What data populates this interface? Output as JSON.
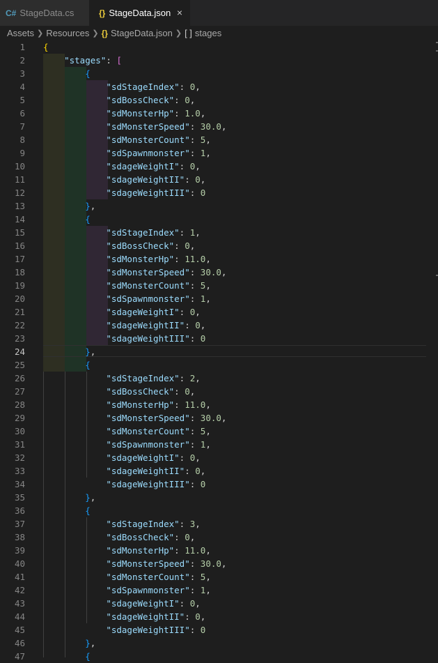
{
  "tabs": [
    {
      "icon": "C#",
      "label": "StageData.cs",
      "active": false
    },
    {
      "icon": "{}",
      "label": "StageData.json",
      "active": true,
      "close": "×"
    }
  ],
  "breadcrumb": {
    "assets": "Assets",
    "resources": "Resources",
    "json_icon": "{}",
    "file": "StageData.json",
    "array_icon": "[ ]",
    "node": "stages"
  },
  "editor": {
    "current_line": 24,
    "first_line": 1,
    "lines": [
      [
        [
          "b1",
          "{"
        ]
      ],
      [
        [
          "p",
          "    "
        ],
        [
          "k",
          "\"stages\""
        ],
        [
          "p",
          ": "
        ],
        [
          "b2",
          "["
        ]
      ],
      [
        [
          "p",
          "        "
        ],
        [
          "b3",
          "{"
        ]
      ],
      [
        [
          "p",
          "            "
        ],
        [
          "k",
          "\"sdStageIndex\""
        ],
        [
          "p",
          ": "
        ],
        [
          "n",
          "0"
        ],
        [
          "p",
          ","
        ]
      ],
      [
        [
          "p",
          "            "
        ],
        [
          "k",
          "\"sdBossCheck\""
        ],
        [
          "p",
          ": "
        ],
        [
          "n",
          "0"
        ],
        [
          "p",
          ","
        ]
      ],
      [
        [
          "p",
          "            "
        ],
        [
          "k",
          "\"sdMonsterHp\""
        ],
        [
          "p",
          ": "
        ],
        [
          "n",
          "1.0"
        ],
        [
          "p",
          ","
        ]
      ],
      [
        [
          "p",
          "            "
        ],
        [
          "k",
          "\"sdMonsterSpeed\""
        ],
        [
          "p",
          ": "
        ],
        [
          "n",
          "30.0"
        ],
        [
          "p",
          ","
        ]
      ],
      [
        [
          "p",
          "            "
        ],
        [
          "k",
          "\"sdMonsterCount\""
        ],
        [
          "p",
          ": "
        ],
        [
          "n",
          "5"
        ],
        [
          "p",
          ","
        ]
      ],
      [
        [
          "p",
          "            "
        ],
        [
          "k",
          "\"sdSpawnmonster\""
        ],
        [
          "p",
          ": "
        ],
        [
          "n",
          "1"
        ],
        [
          "p",
          ","
        ]
      ],
      [
        [
          "p",
          "            "
        ],
        [
          "k",
          "\"sdageWeightI\""
        ],
        [
          "p",
          ": "
        ],
        [
          "n",
          "0"
        ],
        [
          "p",
          ","
        ]
      ],
      [
        [
          "p",
          "            "
        ],
        [
          "k",
          "\"sdageWeightII\""
        ],
        [
          "p",
          ": "
        ],
        [
          "n",
          "0"
        ],
        [
          "p",
          ","
        ]
      ],
      [
        [
          "p",
          "            "
        ],
        [
          "k",
          "\"sdageWeightIII\""
        ],
        [
          "p",
          ": "
        ],
        [
          "n",
          "0"
        ]
      ],
      [
        [
          "p",
          "        "
        ],
        [
          "b3",
          "}"
        ],
        [
          "p",
          ","
        ]
      ],
      [
        [
          "p",
          "        "
        ],
        [
          "b3",
          "{"
        ]
      ],
      [
        [
          "p",
          "            "
        ],
        [
          "k",
          "\"sdStageIndex\""
        ],
        [
          "p",
          ": "
        ],
        [
          "n",
          "1"
        ],
        [
          "p",
          ","
        ]
      ],
      [
        [
          "p",
          "            "
        ],
        [
          "k",
          "\"sdBossCheck\""
        ],
        [
          "p",
          ": "
        ],
        [
          "n",
          "0"
        ],
        [
          "p",
          ","
        ]
      ],
      [
        [
          "p",
          "            "
        ],
        [
          "k",
          "\"sdMonsterHp\""
        ],
        [
          "p",
          ": "
        ],
        [
          "n",
          "11.0"
        ],
        [
          "p",
          ","
        ]
      ],
      [
        [
          "p",
          "            "
        ],
        [
          "k",
          "\"sdMonsterSpeed\""
        ],
        [
          "p",
          ": "
        ],
        [
          "n",
          "30.0"
        ],
        [
          "p",
          ","
        ]
      ],
      [
        [
          "p",
          "            "
        ],
        [
          "k",
          "\"sdMonsterCount\""
        ],
        [
          "p",
          ": "
        ],
        [
          "n",
          "5"
        ],
        [
          "p",
          ","
        ]
      ],
      [
        [
          "p",
          "            "
        ],
        [
          "k",
          "\"sdSpawnmonster\""
        ],
        [
          "p",
          ": "
        ],
        [
          "n",
          "1"
        ],
        [
          "p",
          ","
        ]
      ],
      [
        [
          "p",
          "            "
        ],
        [
          "k",
          "\"sdageWeightI\""
        ],
        [
          "p",
          ": "
        ],
        [
          "n",
          "0"
        ],
        [
          "p",
          ","
        ]
      ],
      [
        [
          "p",
          "            "
        ],
        [
          "k",
          "\"sdageWeightII\""
        ],
        [
          "p",
          ": "
        ],
        [
          "n",
          "0"
        ],
        [
          "p",
          ","
        ]
      ],
      [
        [
          "p",
          "            "
        ],
        [
          "k",
          "\"sdageWeightIII\""
        ],
        [
          "p",
          ": "
        ],
        [
          "n",
          "0"
        ]
      ],
      [
        [
          "p",
          "        "
        ],
        [
          "b3",
          "}"
        ],
        [
          "p",
          ","
        ]
      ],
      [
        [
          "p",
          "        "
        ],
        [
          "b3",
          "{"
        ]
      ],
      [
        [
          "p",
          "            "
        ],
        [
          "k",
          "\"sdStageIndex\""
        ],
        [
          "p",
          ": "
        ],
        [
          "n",
          "2"
        ],
        [
          "p",
          ","
        ]
      ],
      [
        [
          "p",
          "            "
        ],
        [
          "k",
          "\"sdBossCheck\""
        ],
        [
          "p",
          ": "
        ],
        [
          "n",
          "0"
        ],
        [
          "p",
          ","
        ]
      ],
      [
        [
          "p",
          "            "
        ],
        [
          "k",
          "\"sdMonsterHp\""
        ],
        [
          "p",
          ": "
        ],
        [
          "n",
          "11.0"
        ],
        [
          "p",
          ","
        ]
      ],
      [
        [
          "p",
          "            "
        ],
        [
          "k",
          "\"sdMonsterSpeed\""
        ],
        [
          "p",
          ": "
        ],
        [
          "n",
          "30.0"
        ],
        [
          "p",
          ","
        ]
      ],
      [
        [
          "p",
          "            "
        ],
        [
          "k",
          "\"sdMonsterCount\""
        ],
        [
          "p",
          ": "
        ],
        [
          "n",
          "5"
        ],
        [
          "p",
          ","
        ]
      ],
      [
        [
          "p",
          "            "
        ],
        [
          "k",
          "\"sdSpawnmonster\""
        ],
        [
          "p",
          ": "
        ],
        [
          "n",
          "1"
        ],
        [
          "p",
          ","
        ]
      ],
      [
        [
          "p",
          "            "
        ],
        [
          "k",
          "\"sdageWeightI\""
        ],
        [
          "p",
          ": "
        ],
        [
          "n",
          "0"
        ],
        [
          "p",
          ","
        ]
      ],
      [
        [
          "p",
          "            "
        ],
        [
          "k",
          "\"sdageWeightII\""
        ],
        [
          "p",
          ": "
        ],
        [
          "n",
          "0"
        ],
        [
          "p",
          ","
        ]
      ],
      [
        [
          "p",
          "            "
        ],
        [
          "k",
          "\"sdageWeightIII\""
        ],
        [
          "p",
          ": "
        ],
        [
          "n",
          "0"
        ]
      ],
      [
        [
          "p",
          "        "
        ],
        [
          "b3",
          "}"
        ],
        [
          "p",
          ","
        ]
      ],
      [
        [
          "p",
          "        "
        ],
        [
          "b3",
          "{"
        ]
      ],
      [
        [
          "p",
          "            "
        ],
        [
          "k",
          "\"sdStageIndex\""
        ],
        [
          "p",
          ": "
        ],
        [
          "n",
          "3"
        ],
        [
          "p",
          ","
        ]
      ],
      [
        [
          "p",
          "            "
        ],
        [
          "k",
          "\"sdBossCheck\""
        ],
        [
          "p",
          ": "
        ],
        [
          "n",
          "0"
        ],
        [
          "p",
          ","
        ]
      ],
      [
        [
          "p",
          "            "
        ],
        [
          "k",
          "\"sdMonsterHp\""
        ],
        [
          "p",
          ": "
        ],
        [
          "n",
          "11.0"
        ],
        [
          "p",
          ","
        ]
      ],
      [
        [
          "p",
          "            "
        ],
        [
          "k",
          "\"sdMonsterSpeed\""
        ],
        [
          "p",
          ": "
        ],
        [
          "n",
          "30.0"
        ],
        [
          "p",
          ","
        ]
      ],
      [
        [
          "p",
          "            "
        ],
        [
          "k",
          "\"sdMonsterCount\""
        ],
        [
          "p",
          ": "
        ],
        [
          "n",
          "5"
        ],
        [
          "p",
          ","
        ]
      ],
      [
        [
          "p",
          "            "
        ],
        [
          "k",
          "\"sdSpawnmonster\""
        ],
        [
          "p",
          ": "
        ],
        [
          "n",
          "1"
        ],
        [
          "p",
          ","
        ]
      ],
      [
        [
          "p",
          "            "
        ],
        [
          "k",
          "\"sdageWeightI\""
        ],
        [
          "p",
          ": "
        ],
        [
          "n",
          "0"
        ],
        [
          "p",
          ","
        ]
      ],
      [
        [
          "p",
          "            "
        ],
        [
          "k",
          "\"sdageWeightII\""
        ],
        [
          "p",
          ": "
        ],
        [
          "n",
          "0"
        ],
        [
          "p",
          ","
        ]
      ],
      [
        [
          "p",
          "            "
        ],
        [
          "k",
          "\"sdageWeightIII\""
        ],
        [
          "p",
          ": "
        ],
        [
          "n",
          "0"
        ]
      ],
      [
        [
          "p",
          "        "
        ],
        [
          "b3",
          "}"
        ],
        [
          "p",
          ","
        ]
      ],
      [
        [
          "p",
          "        "
        ],
        [
          "b3",
          "{"
        ]
      ]
    ]
  },
  "colors": {
    "background": "#1e1e1e",
    "key": "#9cdcfe",
    "number": "#b5cea8",
    "bracket_level1": "#ffd700",
    "bracket_level2": "#da70d6",
    "bracket_level3": "#179fff",
    "line_number": "#858585"
  }
}
